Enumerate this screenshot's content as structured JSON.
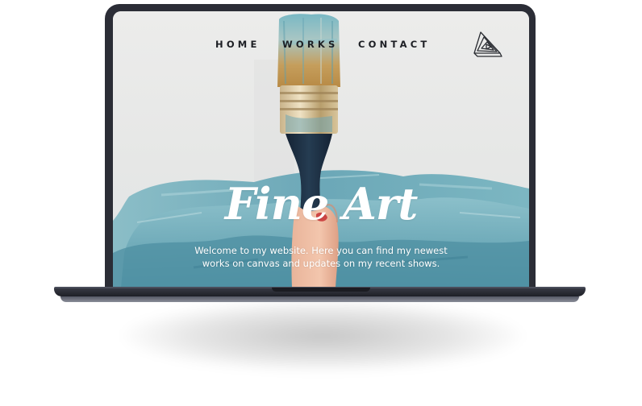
{
  "nav": {
    "home": "HOME",
    "works": "WORKS",
    "contact": "CONTACT"
  },
  "logo": {
    "icon": "play-triangle-logo-icon"
  },
  "hero": {
    "title": "Fine Art",
    "subtitle_line1": "Welcome to my website. Here you can find my newest",
    "subtitle_line2": "works on canvas and updates on my recent shows."
  },
  "colors": {
    "nav_text": "#1d1f24",
    "paint_blue": "#5fa0b0",
    "bristle_tan": "#c8a566",
    "handle": "#1c2c3d",
    "laptop_frame": "#2b2d36",
    "background": "#ffffff"
  }
}
